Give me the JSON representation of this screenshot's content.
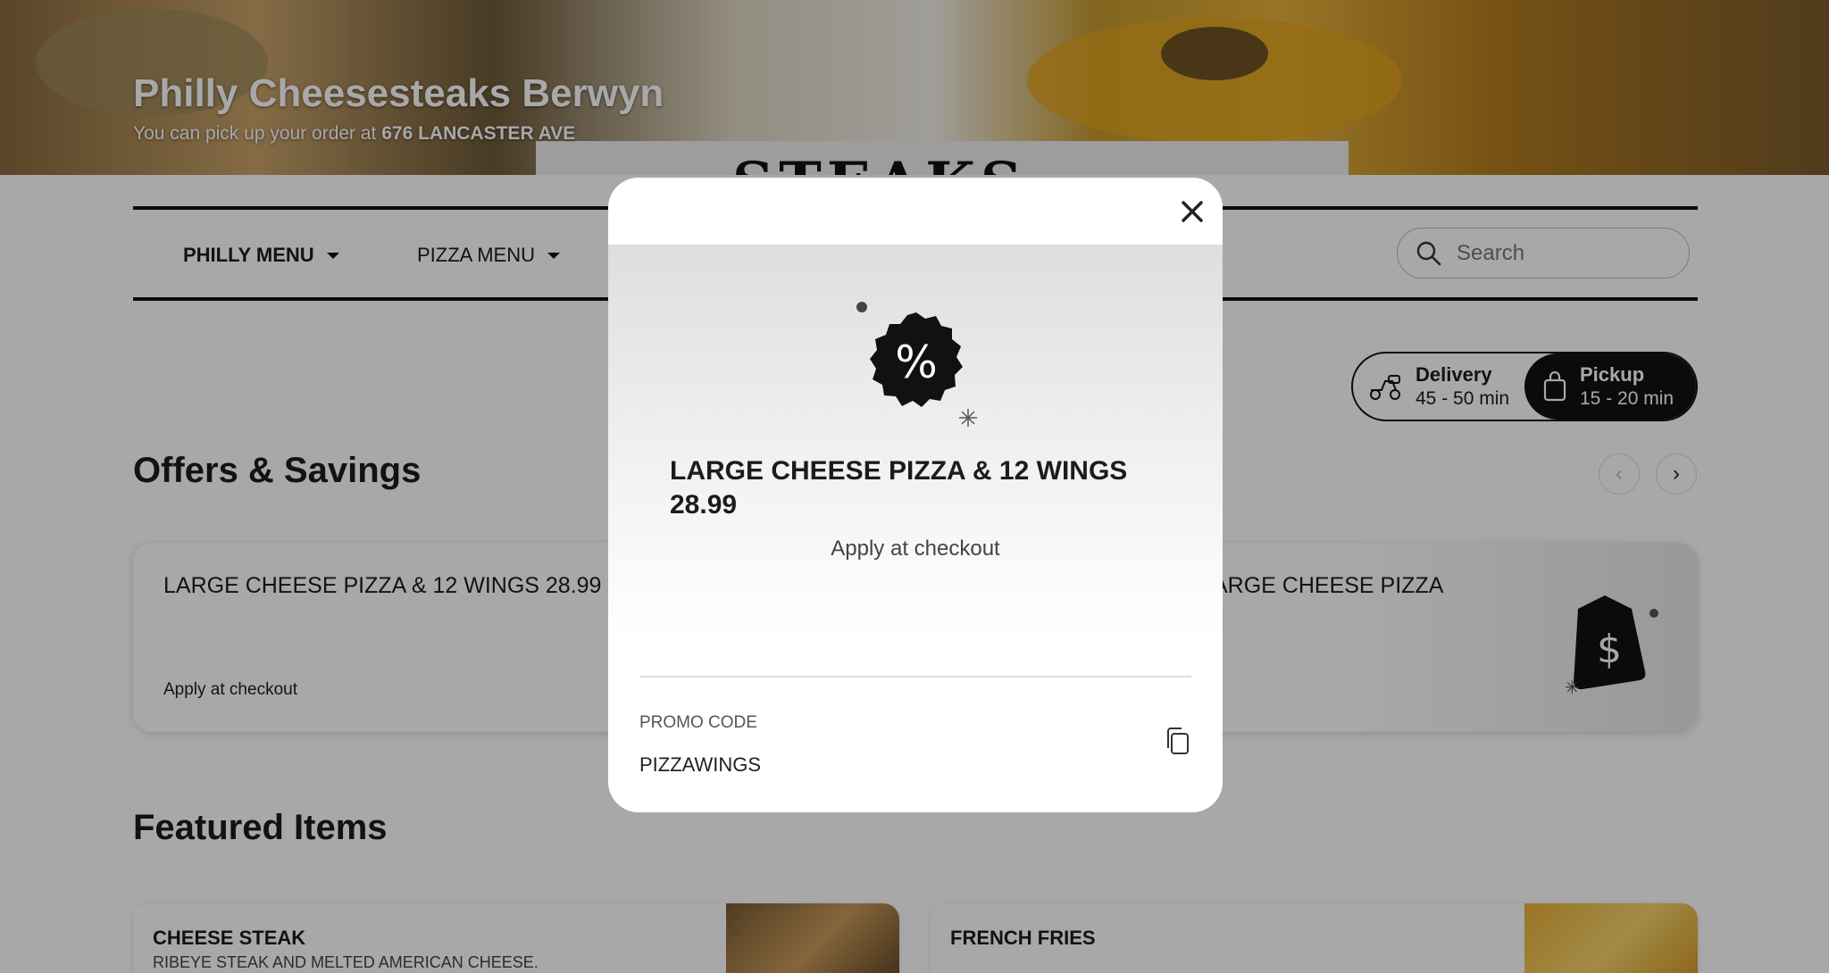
{
  "hero": {
    "title": "Philly Cheesesteaks Berwyn",
    "subtitle_prefix": "You can pick up your order at ",
    "address": "676 LANCASTER AVE",
    "sign_text": "STEAKS"
  },
  "nav": {
    "items": [
      {
        "label": "PHILLY MENU",
        "active": true
      },
      {
        "label": "PIZZA MENU",
        "active": false
      }
    ],
    "search_placeholder": "Search"
  },
  "fulfillment": {
    "delivery": {
      "label": "Delivery",
      "time": "45 - 50 min"
    },
    "pickup": {
      "label": "Pickup",
      "time": "15 - 20 min",
      "selected": true
    }
  },
  "offers": {
    "title": "Offers & Savings",
    "cards": [
      {
        "title": "LARGE CHEESE PIZZA & 12 WINGS 28.99",
        "sub": "Apply at checkout"
      },
      {
        "title": "ARGE CHEESE PIZZA"
      }
    ]
  },
  "featured": {
    "title": "Featured Items",
    "items": [
      {
        "title": "CHEESE STEAK",
        "desc": "RIBEYE STEAK AND MELTED AMERICAN CHEESE."
      },
      {
        "title": "FRENCH FRIES"
      }
    ]
  },
  "modal": {
    "title": "LARGE CHEESE PIZZA & 12 WINGS 28.99",
    "apply": "Apply at checkout",
    "promo_label": "PROMO CODE",
    "promo_code": "PIZZAWINGS",
    "badge_icon": "percent-badge-icon"
  },
  "colors": {
    "text": "#1c1c1c",
    "dark": "#111111",
    "overlay": "rgba(0,0,0,0.34)"
  }
}
